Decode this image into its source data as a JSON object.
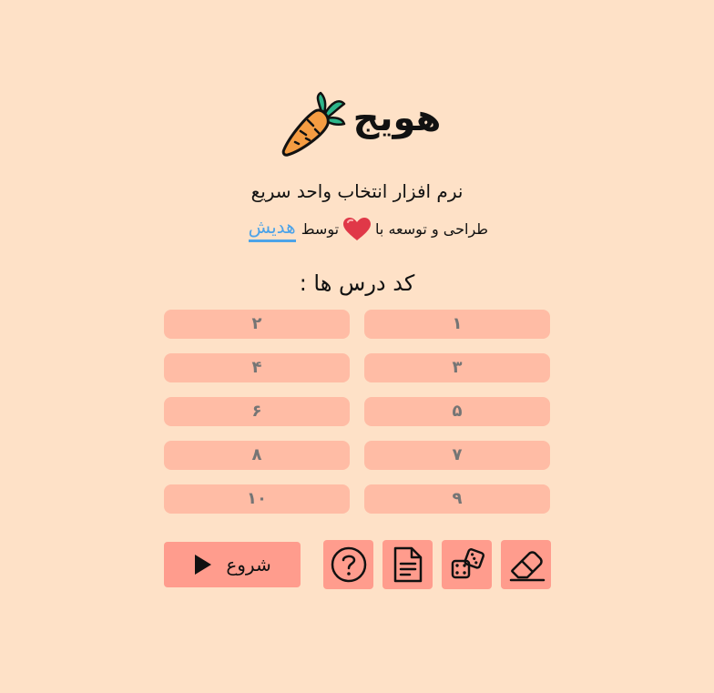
{
  "header": {
    "app_title": "هویج",
    "logo_icon": "carrot-icon"
  },
  "subtitle": "نرم افزار انتخاب واحد سریع",
  "credits": {
    "prefix": "طراحی و توسعه با",
    "heart_icon": "heart-icon",
    "by": "توسط",
    "author": "هدیش"
  },
  "codes": {
    "label": "کد درس ها :",
    "placeholders": [
      "۱",
      "۲",
      "۳",
      "۴",
      "۵",
      "۶",
      "۷",
      "۸",
      "۹",
      "۱۰"
    ]
  },
  "actions": {
    "start_label": "شروع",
    "start_icon": "play-icon",
    "help_icon": "question-circle-icon",
    "document_icon": "document-icon",
    "dice_icon": "dice-icon",
    "eraser_icon": "eraser-icon"
  },
  "colors": {
    "background": "#fee1c7",
    "input": "#ffbca5",
    "button": "#ff9c8d",
    "link": "#4da3e8"
  }
}
